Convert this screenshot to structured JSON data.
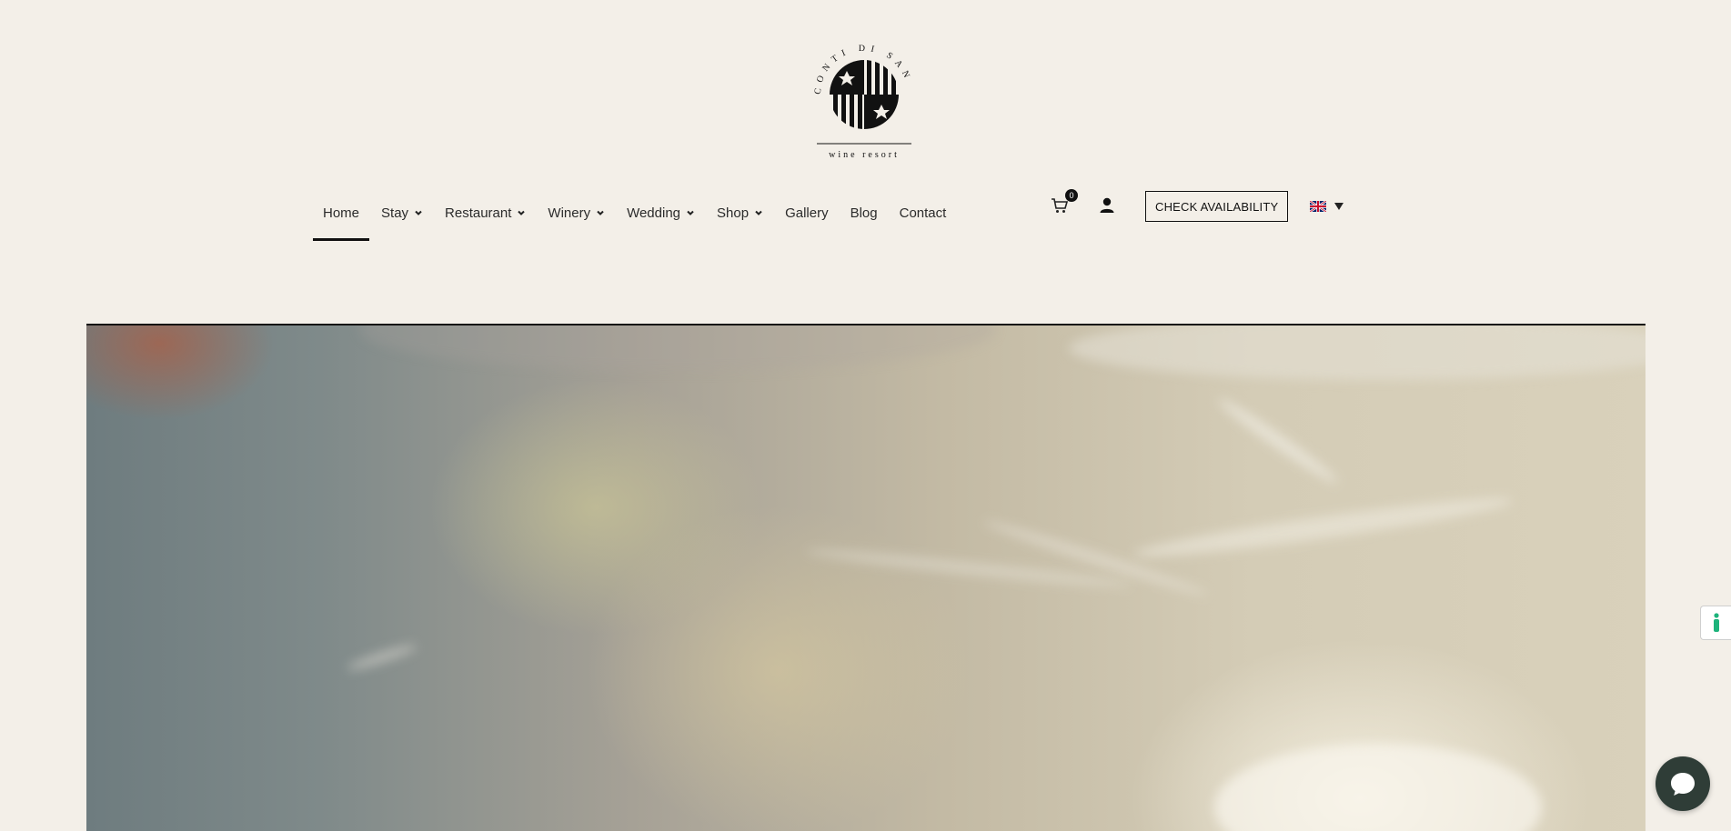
{
  "logo": {
    "ring_text": "CONTI DI SAN BONIFACIO",
    "sub_text": "wine resort"
  },
  "nav": {
    "items": [
      {
        "label": "Home",
        "active": true,
        "has_dropdown": false
      },
      {
        "label": "Stay",
        "has_dropdown": true
      },
      {
        "label": "Restaurant",
        "has_dropdown": true
      },
      {
        "label": "Winery",
        "has_dropdown": true
      },
      {
        "label": "Wedding",
        "has_dropdown": true
      },
      {
        "label": "Shop",
        "has_dropdown": true
      },
      {
        "label": "Gallery",
        "has_dropdown": false
      },
      {
        "label": "Blog",
        "has_dropdown": false
      },
      {
        "label": "Contact",
        "has_dropdown": false
      }
    ]
  },
  "header_tools": {
    "cart_count": "0",
    "check_availability_label": "CHECK AVAILABILITY",
    "language_icon": "uk-flag-icon"
  },
  "colors": {
    "page_background": "#f3efe8",
    "text": "#2b2b2b",
    "chat_button": "#2f3d37"
  }
}
